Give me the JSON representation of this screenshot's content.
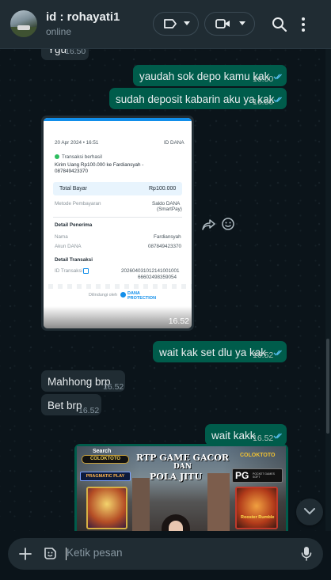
{
  "header": {
    "contact_name": "id : rohayati1",
    "status": "online"
  },
  "icons": {
    "label": "label-icon",
    "video": "video-call-icon",
    "search": "search-icon",
    "menu": "more-vertical-icon"
  },
  "messages": [
    {
      "dir": "in",
      "text": "Ygu",
      "time": "16.50"
    },
    {
      "dir": "out",
      "text": "yaudah sok depo kamu kak",
      "time": "16.50"
    },
    {
      "dir": "out",
      "text": "sudah deposit kabarin aku ya kak",
      "time": "16.50"
    },
    {
      "dir": "in",
      "type": "image",
      "time": "16.52"
    },
    {
      "dir": "out",
      "text": "wait kak set dlu ya kak",
      "time": "16.52"
    },
    {
      "dir": "in",
      "text": "Mahhong brp",
      "time": "16.52"
    },
    {
      "dir": "in",
      "text": "Bet brp",
      "time": "16.52"
    },
    {
      "dir": "out",
      "text": "wait kakk",
      "time": "16.52"
    }
  ],
  "receipt": {
    "date": "20 Apr 2024 • 16:51",
    "id_label": "ID DANA",
    "status": "Transaksi berhasil",
    "title_line1": "Kirim Uang Rp100.000 ke Fardiansyah -",
    "title_line2": "087849423370",
    "total_label": "Total Bayar",
    "total_value": "Rp100.000",
    "method_label": "Metode Pembayaran",
    "method_value1": "Saldo DANA",
    "method_value2": "(SmartPay)",
    "recipient_heading": "Detail Penerima",
    "name_label": "Nama",
    "name_value": "Fardiansyah",
    "account_label": "Akun DANA",
    "account_value": "087849423370",
    "tx_heading": "Detail Transaksi",
    "tx_label": "ID Transaksi",
    "tx_value1": "202604031012141001001",
    "tx_value2": "66602498359054",
    "footer_label": "Dilindungi oleh",
    "footer_brand1": "DANA",
    "footer_brand2": "PROTECTION"
  },
  "banner": {
    "search_label": "Search",
    "brand": "COLOKTOTO",
    "headline1": "RTP GAME GACOR",
    "headline2": "DAN",
    "headline3": "POLA JITU",
    "logo_right": "COLOKTOTO",
    "pragmatic": "PRAGMATIC PLAY",
    "pg": "PG",
    "pg_sub": "POCKET GAMES SOFT",
    "game_right": "Rooster Rumble"
  },
  "composer": {
    "placeholder": "Ketik pesan"
  },
  "colors": {
    "outgoing": "#005c4b",
    "incoming": "#202c33",
    "background": "#0b141a",
    "tick": "#53bdeb"
  }
}
